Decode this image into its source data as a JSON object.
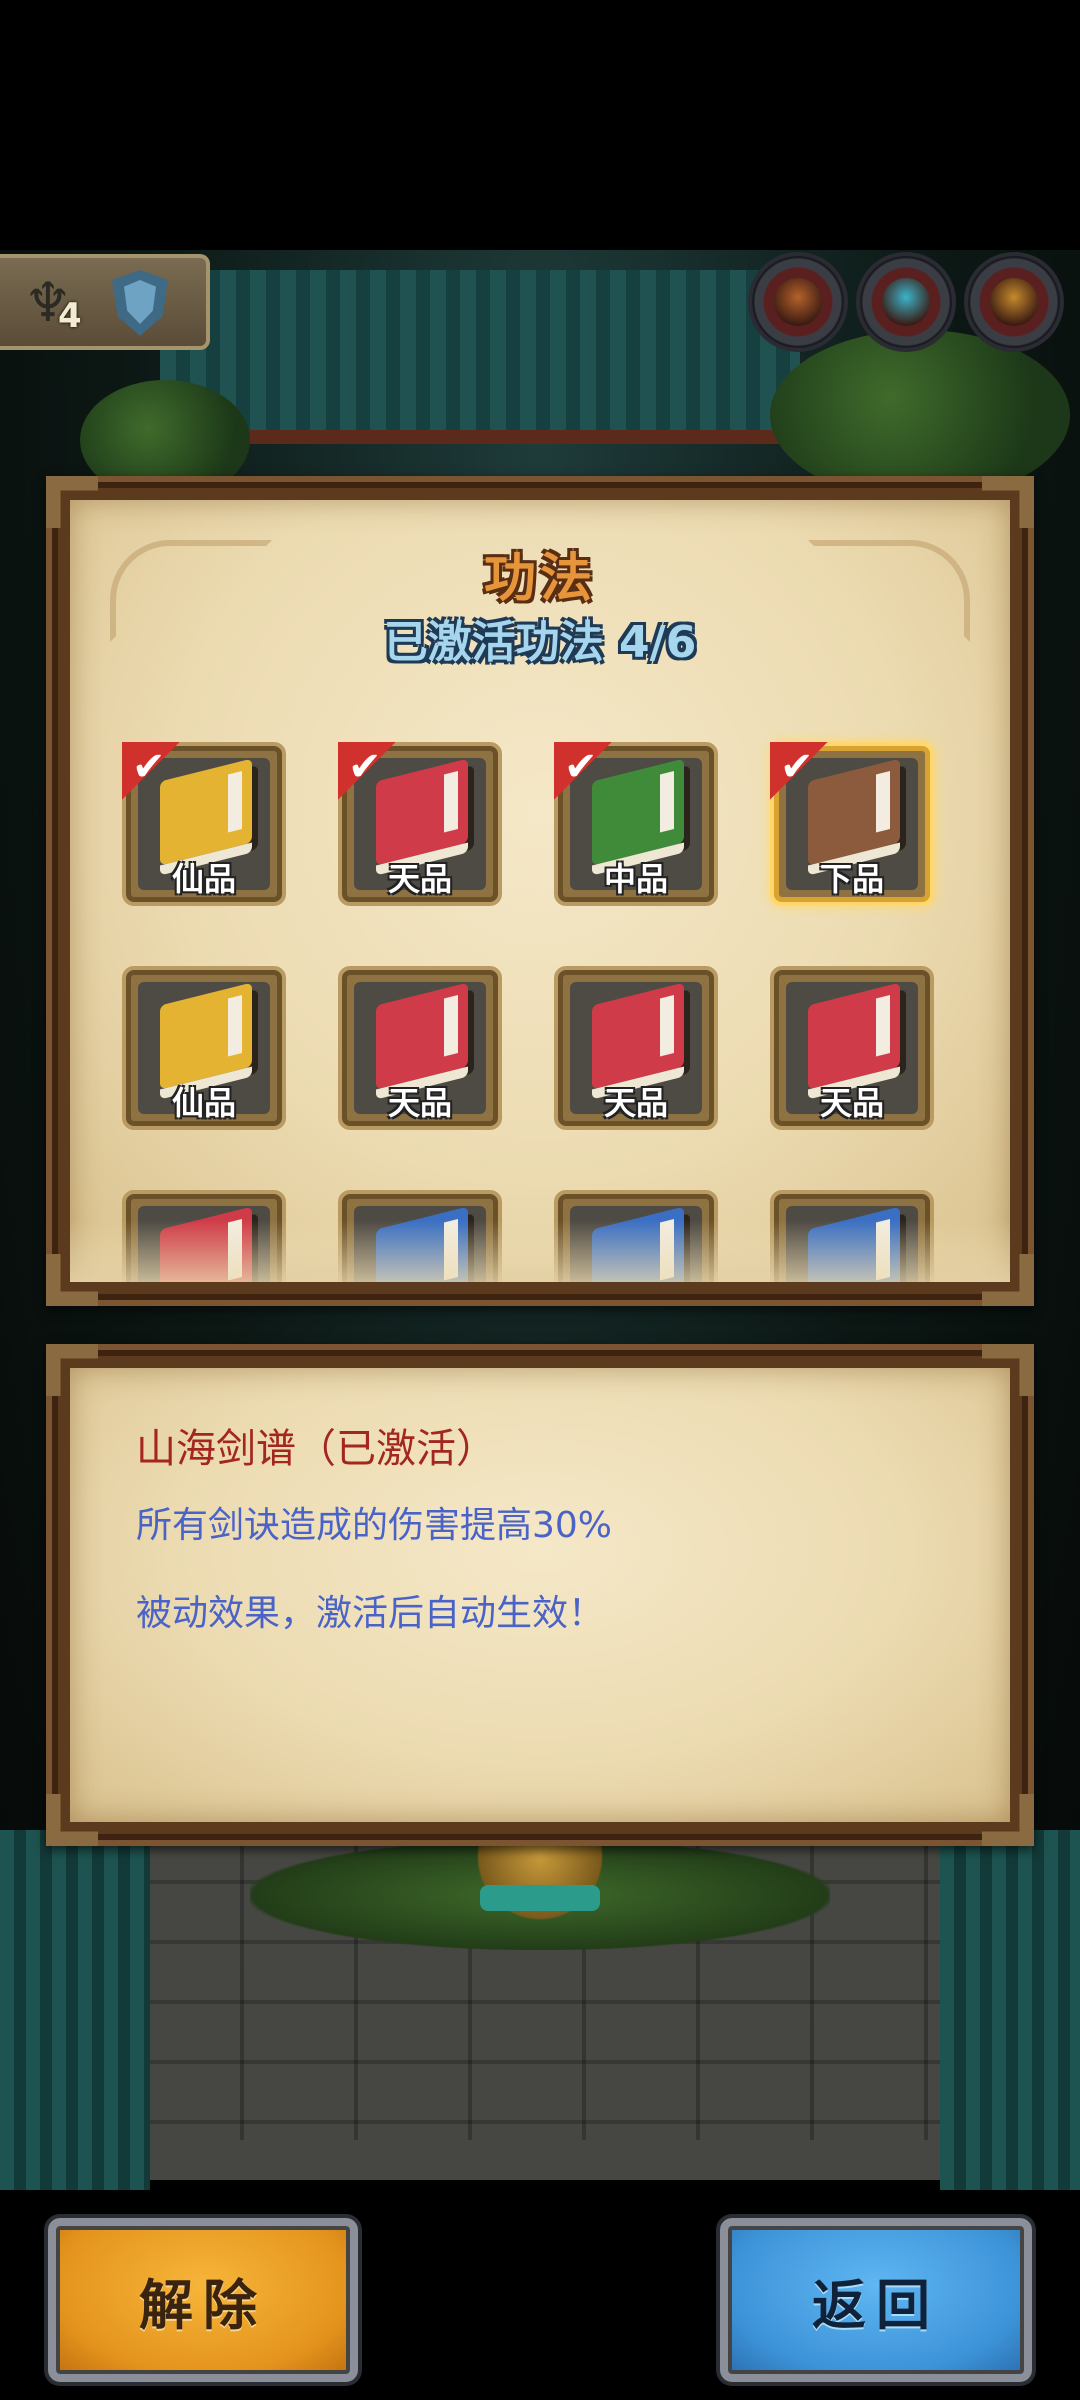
{
  "hud": {
    "level": "4",
    "rank_icon": "trident-icon",
    "shield_icon": "shield-icon",
    "circle_buttons": [
      {
        "name": "character-portrait-icon",
        "color": "#b4622b"
      },
      {
        "name": "monster-portrait-icon",
        "color": "#3bb3c9"
      },
      {
        "name": "warrior-portrait-icon",
        "color": "#c48a2c"
      }
    ]
  },
  "panel": {
    "title": "功法",
    "subtitle": "已激活功法 4/6"
  },
  "slots": [
    {
      "label": "仙品",
      "color": "#e3b331",
      "checked": true,
      "selected": false
    },
    {
      "label": "天品",
      "color": "#cf3b48",
      "checked": true,
      "selected": false
    },
    {
      "label": "中品",
      "color": "#3f8b3a",
      "checked": true,
      "selected": false
    },
    {
      "label": "下品",
      "color": "#8c5a3c",
      "checked": true,
      "selected": true
    },
    {
      "label": "仙品",
      "color": "#e3b331",
      "checked": false,
      "selected": false
    },
    {
      "label": "天品",
      "color": "#cf3b48",
      "checked": false,
      "selected": false
    },
    {
      "label": "天品",
      "color": "#cf3b48",
      "checked": false,
      "selected": false
    },
    {
      "label": "天品",
      "color": "#cf3b48",
      "checked": false,
      "selected": false
    },
    {
      "label": "",
      "color": "#cf3b48",
      "checked": false,
      "selected": false
    },
    {
      "label": "",
      "color": "#3a6fc4",
      "checked": false,
      "selected": false
    },
    {
      "label": "",
      "color": "#3a6fc4",
      "checked": false,
      "selected": false
    },
    {
      "label": "",
      "color": "#3a6fc4",
      "checked": false,
      "selected": false
    }
  ],
  "description": {
    "title": "山海剑谱（已激活）",
    "line1": "所有剑诀造成的伤害提高30%",
    "line2": "被动效果，激活后自动生效！"
  },
  "buttons": {
    "unlock": "解除",
    "back": "返回"
  },
  "colors": {
    "title_orange": "#e7953a",
    "subtitle_blue": "#a6d5ee",
    "desc_red": "#a3271f",
    "desc_blue": "#4a63c9",
    "button_gold": "#e4941d",
    "button_blue": "#3d93d8"
  }
}
